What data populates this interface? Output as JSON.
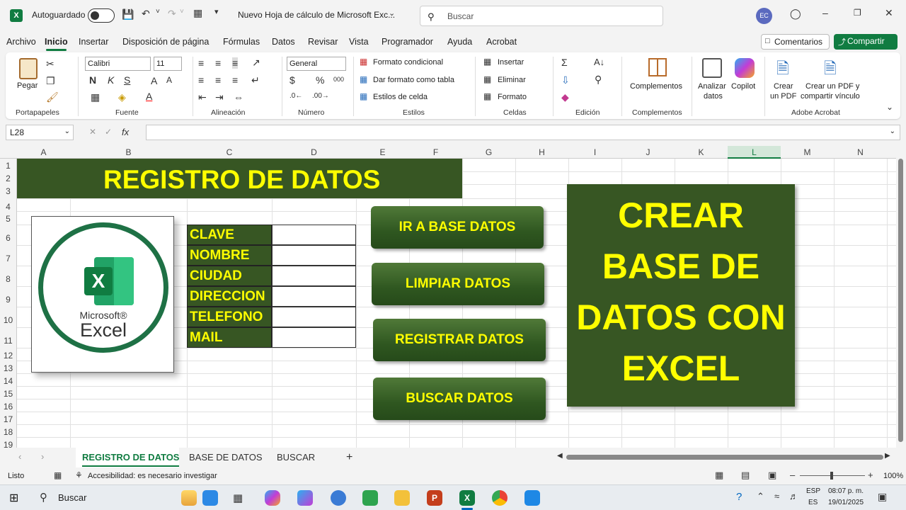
{
  "titlebar": {
    "autosave_label": "Autoguardado",
    "doc_title": "Nuevo Hoja de cálculo de Microsoft Exc...",
    "search_placeholder": "Buscar",
    "avatar_initials": "EC"
  },
  "menu": {
    "items": [
      "Archivo",
      "Inicio",
      "Insertar",
      "Disposición de página",
      "Fórmulas",
      "Datos",
      "Revisar",
      "Vista",
      "Programador",
      "Ayuda",
      "Acrobat"
    ],
    "comments_label": "Comentarios",
    "share_label": "Compartir"
  },
  "ribbon": {
    "paste_label": "Pegar",
    "font_name": "Calibri",
    "font_size": "11",
    "number_format": "General",
    "conditional_format": "Formato condicional",
    "format_as_table": "Dar formato como tabla",
    "cell_styles": "Estilos de celda",
    "insert": "Insertar",
    "delete": "Eliminar",
    "format": "Formato",
    "addins": "Complementos",
    "analyze_1": "Analizar",
    "analyze_2": "datos",
    "copilot": "Copilot",
    "pdf_1": "Crear",
    "pdf_2": "un PDF",
    "pdf_share_1": "Crear un PDF y",
    "pdf_share_2": "compartir vínculo",
    "groups": {
      "clipboard": "Portapapeles",
      "font": "Fuente",
      "alignment": "Alineación",
      "number": "Número",
      "styles": "Estilos",
      "cells": "Celdas",
      "editing": "Edición",
      "addins": "Complementos",
      "acrobat": "Adobe Acrobat"
    }
  },
  "formula_bar": {
    "name_box": "L28",
    "fx": "fx"
  },
  "grid": {
    "columns": [
      "A",
      "B",
      "C",
      "D",
      "E",
      "F",
      "G",
      "H",
      "I",
      "J",
      "K",
      "L",
      "M",
      "N"
    ],
    "rows": [
      "1",
      "2",
      "3",
      "4",
      "5",
      "6",
      "7",
      "8",
      "9",
      "10",
      "11",
      "12",
      "13",
      "14",
      "15",
      "16",
      "17",
      "18",
      "19"
    ],
    "selected_column": "L"
  },
  "sheet": {
    "banner": "REGISTRO DE DATOS",
    "logo_brand": "Microsoft®",
    "logo_name": "Excel",
    "logo_letter": "X",
    "fields": [
      "CLAVE",
      "NOMBRE",
      "CIUDAD",
      "DIRECCION",
      "TELEFONO",
      "MAIL"
    ],
    "buttons": [
      "IR A BASE DATOS",
      "LIMPIAR DATOS",
      "REGISTRAR DATOS",
      "BUSCAR DATOS"
    ],
    "big_title_lines": [
      "CREAR",
      "BASE DE",
      "DATOS CON",
      "EXCEL"
    ]
  },
  "tabs": {
    "sheets": [
      "REGISTRO DE DATOS",
      "BASE DE  DATOS",
      "BUSCAR"
    ],
    "active": "REGISTRO DE DATOS"
  },
  "status": {
    "ready": "Listo",
    "accessibility": "Accesibilidad: es necesario investigar",
    "zoom": "100%"
  },
  "taskbar": {
    "search_label": "Buscar",
    "lang_1": "ESP",
    "lang_2": "ES",
    "time": "08:07 p. m.",
    "date": "19/01/2025"
  },
  "colors": {
    "excel_green": "#107c41",
    "banner_green": "#375623",
    "banner_text": "#ffff00"
  }
}
